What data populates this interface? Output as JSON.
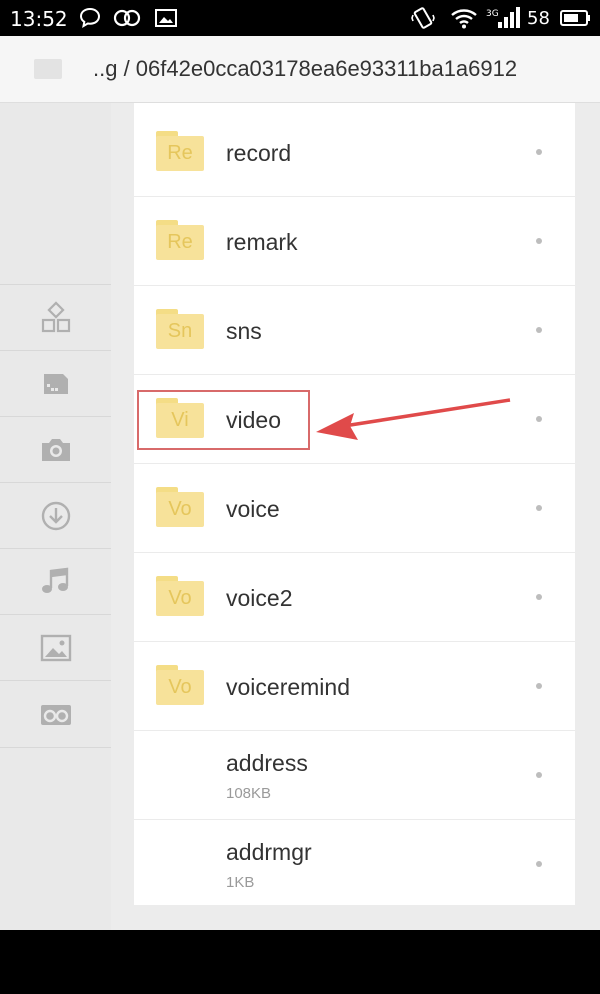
{
  "status_bar": {
    "time": "13:52",
    "battery_level": "58",
    "icons": [
      "chat-bubble-icon",
      "infinity-icon",
      "image-icon",
      "vibrate-icon",
      "wifi-icon",
      "signal-icon",
      "battery-icon"
    ]
  },
  "path_bar": {
    "breadcrumb": "..g / 06f42e0cca03178ea6e93311ba1a6912"
  },
  "sidebar": {
    "items": [
      {
        "icon": "apps-icon"
      },
      {
        "icon": "sdcard-icon"
      },
      {
        "icon": "camera-icon"
      },
      {
        "icon": "download-icon"
      },
      {
        "icon": "music-icon"
      },
      {
        "icon": "picture-icon"
      },
      {
        "icon": "glasses-icon"
      }
    ]
  },
  "files": [
    {
      "name": "record",
      "type": "folder",
      "abbr": "Re"
    },
    {
      "name": "remark",
      "type": "folder",
      "abbr": "Re"
    },
    {
      "name": "sns",
      "type": "folder",
      "abbr": "Sn"
    },
    {
      "name": "video",
      "type": "folder",
      "abbr": "Vi",
      "highlighted": true
    },
    {
      "name": "voice",
      "type": "folder",
      "abbr": "Vo"
    },
    {
      "name": "voice2",
      "type": "folder",
      "abbr": "Vo"
    },
    {
      "name": "voiceremind",
      "type": "folder",
      "abbr": "Vo"
    },
    {
      "name": "address",
      "type": "file",
      "size": "108KB"
    },
    {
      "name": "addrmgr",
      "type": "file",
      "size": "1KB"
    }
  ],
  "colors": {
    "folder": "#f7e29a",
    "folder_text": "#e5c65c",
    "highlight_box": "#d86a6a",
    "arrow": "#e04a4a"
  }
}
